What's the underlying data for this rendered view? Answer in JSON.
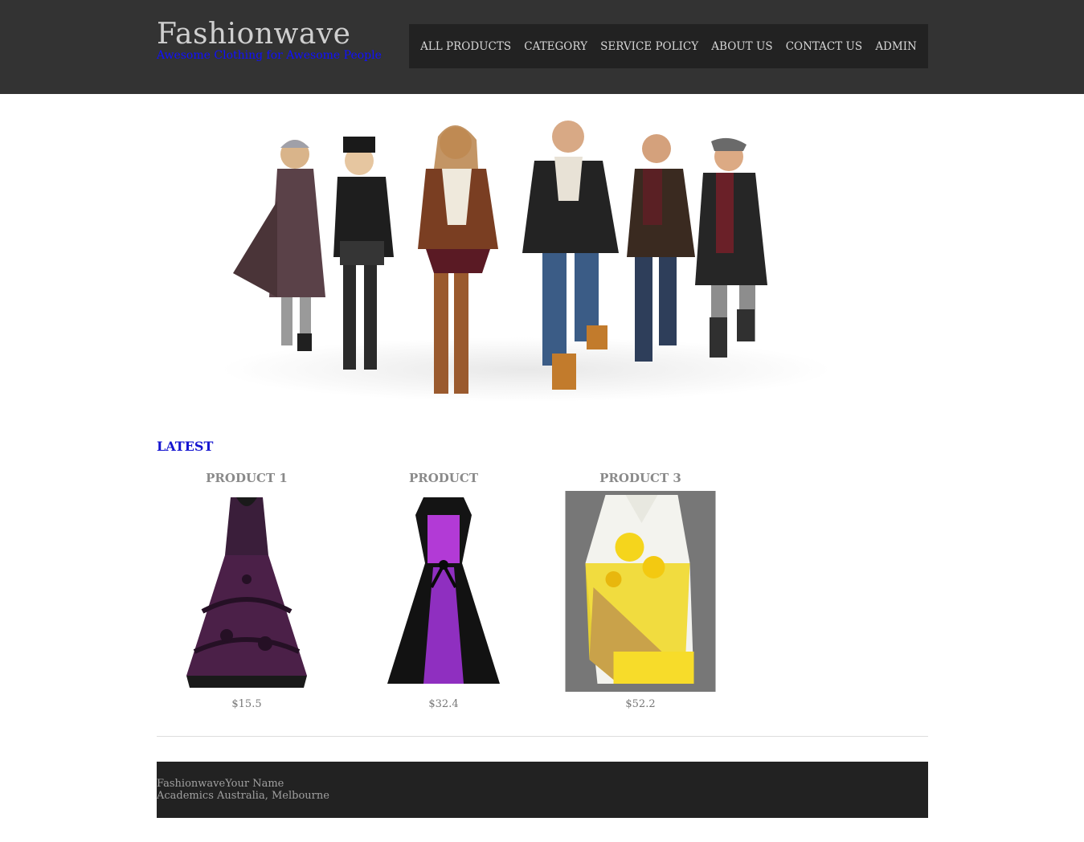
{
  "header": {
    "title": "Fashionwave",
    "tagline": "Awesome Clothing for Awesome People",
    "nav": [
      {
        "label": "ALL PRODUCTS"
      },
      {
        "label": "CATEGORY"
      },
      {
        "label": "SERVICE POLICY"
      },
      {
        "label": "ABOUT US"
      },
      {
        "label": "CONTACT US"
      },
      {
        "label": "ADMIN"
      }
    ],
    "colors": {
      "bar": "#333333",
      "nav": "#222222",
      "tagline": "#1010ff"
    }
  },
  "hero": {
    "image": "group-of-models-in-winter-coats-photo"
  },
  "latest": {
    "title": "LATEST",
    "products": [
      {
        "name": "PRODUCT 1",
        "price": "$15.5",
        "image": "purple-lace-dress-photo"
      },
      {
        "name": "PRODUCT",
        "price": "$32.4",
        "image": "black-purple-butterfly-dress-photo"
      },
      {
        "name": "PRODUCT 3",
        "price": "$52.2",
        "image": "yellow-floral-tunic-photo"
      }
    ]
  },
  "footer": {
    "line1": "FashionwaveYour Name",
    "line2": "Academics Australia, Melbourne"
  }
}
